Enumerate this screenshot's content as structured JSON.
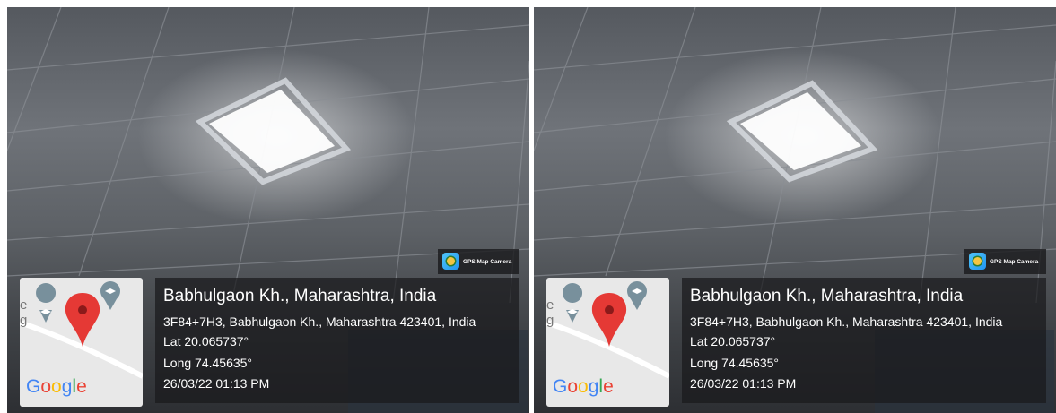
{
  "panels": [
    {
      "location_title": "Babhulgaon Kh., Maharashtra, India",
      "address": "3F84+7H3, Babhulgaon Kh., Maharashtra 423401, India",
      "latitude": "Lat 20.065737°",
      "longitude": "Long 74.45635°",
      "datetime": "26/03/22 01:13 PM",
      "app_badge": "GPS Map Camera",
      "map_partial_label": "e\ng",
      "map_logo": "Google"
    },
    {
      "location_title": "Babhulgaon Kh., Maharashtra, India",
      "address": "3F84+7H3, Babhulgaon Kh., Maharashtra 423401, India",
      "latitude": "Lat 20.065737°",
      "longitude": "Long 74.45635°",
      "datetime": "26/03/22 01:13 PM",
      "app_badge": "GPS Map Camera",
      "map_partial_label": "e\ng",
      "map_logo": "Google"
    }
  ],
  "icons": [
    "map-pin-icon",
    "school-marker-icon",
    "gps-map-camera-app-icon"
  ],
  "colors": {
    "pin": "#e53935",
    "marker": "#78909c",
    "overlay": "#19191c"
  }
}
